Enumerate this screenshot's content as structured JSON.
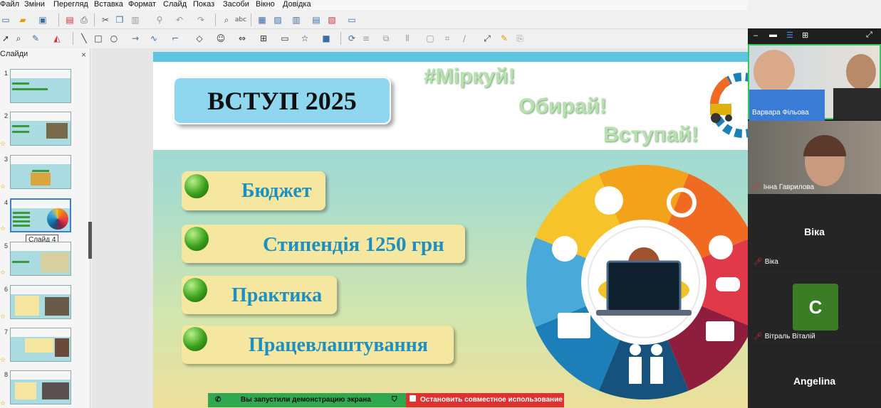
{
  "menu": [
    "Файл",
    "Зміни",
    "Перегляд",
    "Вставка",
    "Формат",
    "Слайд",
    "Показ",
    "Засоби",
    "Вікно",
    "Довідка"
  ],
  "panel": {
    "title": "Слайди",
    "close": "×",
    "tooltip": "Слайд 4"
  },
  "thumbnails": [
    {
      "num": "1"
    },
    {
      "num": "2"
    },
    {
      "num": "3"
    },
    {
      "num": "4"
    },
    {
      "num": "5"
    },
    {
      "num": "6"
    },
    {
      "num": "7"
    },
    {
      "num": "8"
    }
  ],
  "slide": {
    "title": "ВСТУП 2025",
    "tags": [
      "#Міркуй!",
      "Обирай!",
      "Вступай!"
    ],
    "bullets": [
      "Бюджет",
      "Стипендія 1250 грн",
      "Практика",
      "Працевлаштування"
    ]
  },
  "wheel": {
    "segment_colors": [
      "#f3a21b",
      "#f06a22",
      "#e03a4a",
      "#8f1d3e",
      "#17527e",
      "#1d7fb8",
      "#49a9d8",
      "#f6c32a"
    ]
  },
  "screen_share": {
    "notice": "Вы запустили демонстрацию экрана",
    "stop": "Остановить совместное использование"
  },
  "participants": [
    {
      "name": "Варвара Фільова"
    },
    {
      "name": "Інна Гаврилова"
    },
    {
      "name": "Віка"
    },
    {
      "name": "Вітраль Віталій",
      "initial": "C"
    },
    {
      "name": "Angelina"
    }
  ],
  "colors": {
    "accent": "#1d8fc0",
    "title_box": "#8fd7ee",
    "pill": "#f6e7a0",
    "video_bg": "#232323"
  }
}
